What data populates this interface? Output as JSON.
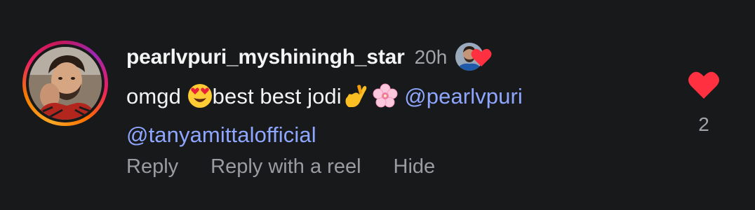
{
  "comment": {
    "username": "pearlvpuri_myshiningh_star",
    "timestamp": "20h",
    "text_start": "omgd ",
    "text_mid": "best best jodi",
    "mention_1": "@pearlvpuri",
    "mention_2": "@tanyamittalofficial",
    "emojis": [
      "heart-eyes-emoji",
      "crossed-fingers-emoji",
      "cherry-blossom-emoji"
    ],
    "creator_liked_icon": "creator-heart-icon"
  },
  "actions": {
    "reply": "Reply",
    "reply_with_reel": "Reply with a reel",
    "hide": "Hide"
  },
  "like": {
    "icon": "heart-filled-icon",
    "count": "2",
    "color": "#ff3040"
  },
  "colors": {
    "background": "#18191b",
    "mention": "#8fa6ff",
    "muted": "#9b9ca1"
  }
}
